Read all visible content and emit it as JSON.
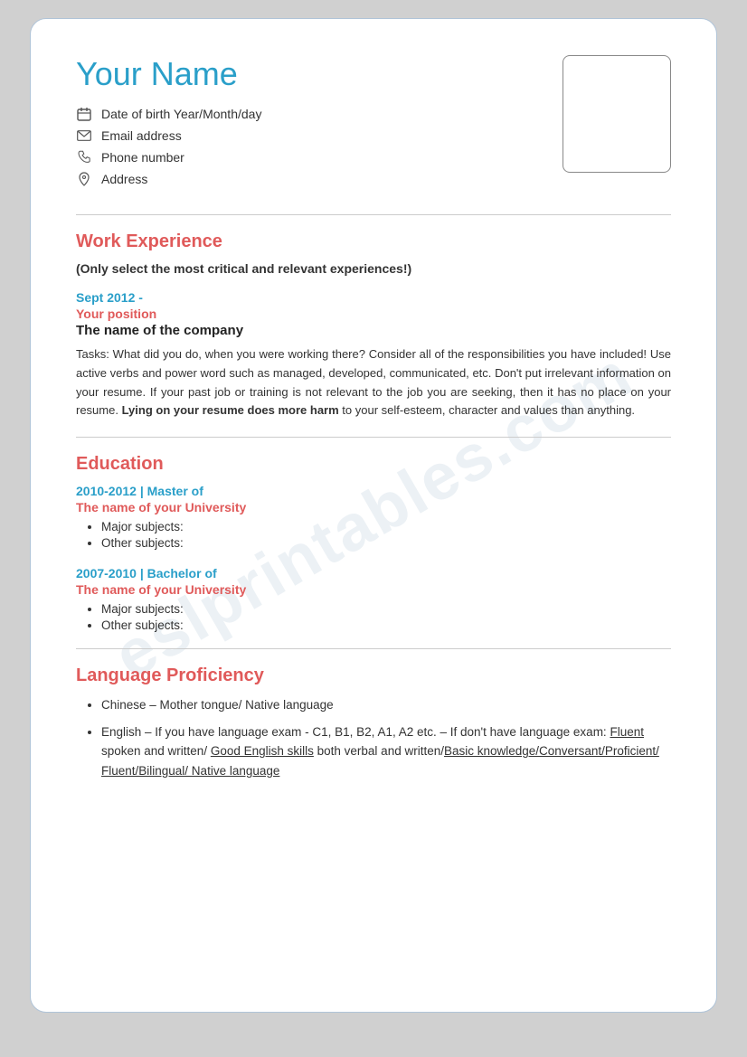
{
  "watermark": "eslprintables.com",
  "header": {
    "name": "Your Name",
    "photo_placeholder": "",
    "contact": {
      "dob_label": "Date of birth Year/Month/day",
      "email_label": "Email address",
      "phone_label": "Phone number",
      "address_label": "Address"
    }
  },
  "work_experience": {
    "section_title": "Work Experience",
    "note": "(Only select the most critical and relevant experiences!)",
    "entries": [
      {
        "date": "Sept 2012 -",
        "position": "Your position",
        "company": "The name of the company",
        "tasks_prefix": "Tasks: What did you do, when you were working there?  Consider all of the responsibilities you have included!  Use active verbs and power word such as managed, developed, communicated, etc.  Don't put irrelevant information on your resume.  If your past job or training is not relevant to the job you are seeking, then it has no place on your resume.",
        "tasks_bold": "Lying on your resume does more harm",
        "tasks_suffix": " to your self-esteem, character and values than anything."
      }
    ]
  },
  "education": {
    "section_title": "Education",
    "entries": [
      {
        "date_degree": "2010-2012   |  Master of",
        "university": "The name of your University",
        "subjects": [
          "Major subjects:",
          "Other subjects:"
        ]
      },
      {
        "date_degree": "2007-2010   |  Bachelor of",
        "university": "The name of your University",
        "subjects": [
          "Major subjects:",
          "Other subjects:"
        ]
      }
    ]
  },
  "language": {
    "section_title": "Language Proficiency",
    "items": [
      {
        "text": "Chinese – Mother tongue/ Native language",
        "underline_parts": []
      },
      {
        "text_prefix": "English – If you have language exam - C1, B1, B2, A1, A2 etc. – If don't have language exam: ",
        "underline1": "Fluent",
        "text_mid1": " spoken and written/ ",
        "underline2": "Good English skills",
        "text_mid2": " both verbal and written/",
        "underline3": "Basic knowledge/Conversant/Proficient/ Fluent/Bilingual/ Native language",
        "text_end": ""
      }
    ]
  }
}
